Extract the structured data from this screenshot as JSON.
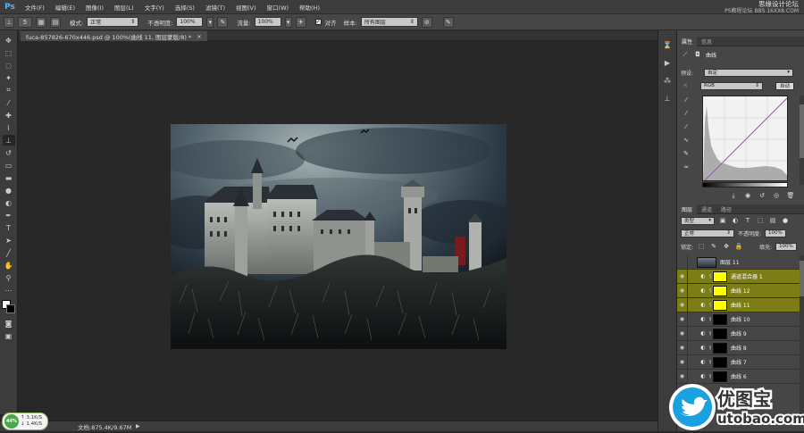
{
  "menubar": {
    "logo": "Ps",
    "items": [
      "文件(F)",
      "编辑(E)",
      "图像(I)",
      "图层(L)",
      "文字(Y)",
      "选择(S)",
      "滤镜(T)",
      "视图(V)",
      "窗口(W)",
      "帮助(H)"
    ],
    "watermark_main": "思缘设计论坛",
    "watermark_site": "PS教程论坛",
    "watermark_url": "BBS.16XX8.COM"
  },
  "options": {
    "brush_size": "5",
    "mode_label": "模式:",
    "mode_value": "正常",
    "opacity_label": "不透明度:",
    "opacity_value": "100%",
    "flow_label": "流量:",
    "flow_value": "100%",
    "aligned_label": "对齐",
    "sample_label": "样本:",
    "sample_value": "所有图层"
  },
  "document": {
    "tab_title": "fuca-857826-670x446.psd @ 100%(曲线 11, 图层蒙版/8) *",
    "status_info": "文档:875.4K/9.67M"
  },
  "network_widget": {
    "percent": "44%",
    "up_rate": "3.1K/S",
    "down_rate": "1.4K/S"
  },
  "properties": {
    "tabs": [
      "属性",
      "信息"
    ],
    "title": "曲线",
    "preset_label": "预设:",
    "preset_value": "自定",
    "channel_value": "RGB",
    "auto_button": "自动"
  },
  "layers": {
    "tabs": [
      "图层",
      "通道",
      "路径"
    ],
    "filter_kind": "类型",
    "blend_mode": "正常",
    "opacity_label": "不透明度:",
    "opacity_value": "100%",
    "lock_label": "锁定:",
    "fill_label": "填充:",
    "fill_value": "100%",
    "rows": [
      {
        "name": "图层 11",
        "visible": false,
        "type": "pixel",
        "selected": false
      },
      {
        "name": "通道混合器 1",
        "visible": true,
        "type": "adjustment",
        "selected": true,
        "mask": "#ffff00"
      },
      {
        "name": "曲线 12",
        "visible": true,
        "type": "adjustment",
        "selected": true,
        "mask": "#ffff00"
      },
      {
        "name": "曲线 11",
        "visible": true,
        "type": "adjustment",
        "selected": true,
        "mask": "#ffff00"
      },
      {
        "name": "曲线 10",
        "visible": true,
        "type": "adjustment",
        "selected": false,
        "mask": "#000000"
      },
      {
        "name": "曲线 9",
        "visible": true,
        "type": "adjustment",
        "selected": false,
        "mask": "#000000"
      },
      {
        "name": "曲线 8",
        "visible": true,
        "type": "adjustment",
        "selected": false,
        "mask": "#000000"
      },
      {
        "name": "曲线 7",
        "visible": true,
        "type": "adjustment",
        "selected": false,
        "mask": "#000000"
      },
      {
        "name": "曲线 6",
        "visible": true,
        "type": "adjustment",
        "selected": false,
        "mask": "#000000"
      }
    ]
  },
  "site_logo": {
    "name": "优图宝",
    "url": "utobao.com"
  }
}
